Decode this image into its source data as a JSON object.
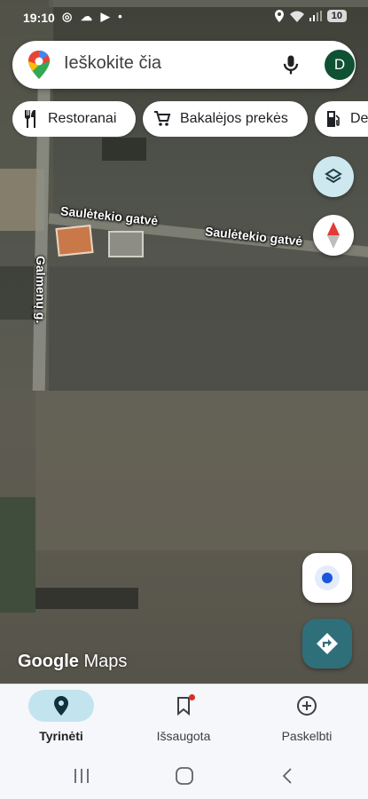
{
  "status_bar": {
    "time": "19:10",
    "left_icons": "◎ ☁ ▶ •",
    "battery": "10"
  },
  "search": {
    "placeholder": "Ieškokite čia",
    "avatar_letter": "D"
  },
  "chips": [
    {
      "label": "Restoranai",
      "icon": "fork-knife-icon"
    },
    {
      "label": "Bakalėjos prekės",
      "icon": "cart-icon"
    },
    {
      "label": "De",
      "icon": "fuel-icon"
    }
  ],
  "map": {
    "labels": [
      {
        "text": "Saulėtekio gatvė"
      },
      {
        "text": "Saulėtekio gatvė"
      },
      {
        "text": "Galmenų g."
      }
    ],
    "logo_google": "Google",
    "logo_maps": "Maps"
  },
  "bottom_nav": [
    {
      "label": "Tyrinėti",
      "icon": "pin-icon",
      "active": true
    },
    {
      "label": "Išsaugota",
      "icon": "bookmark-icon",
      "active": false
    },
    {
      "label": "Paskelbti",
      "icon": "add-circle-icon",
      "active": false
    }
  ],
  "colors": {
    "active_nav_pill": "#c2e4ef",
    "directions_button": "#2f6f7a",
    "avatar": "#0f5132",
    "locate_dot": "#1a56db"
  }
}
